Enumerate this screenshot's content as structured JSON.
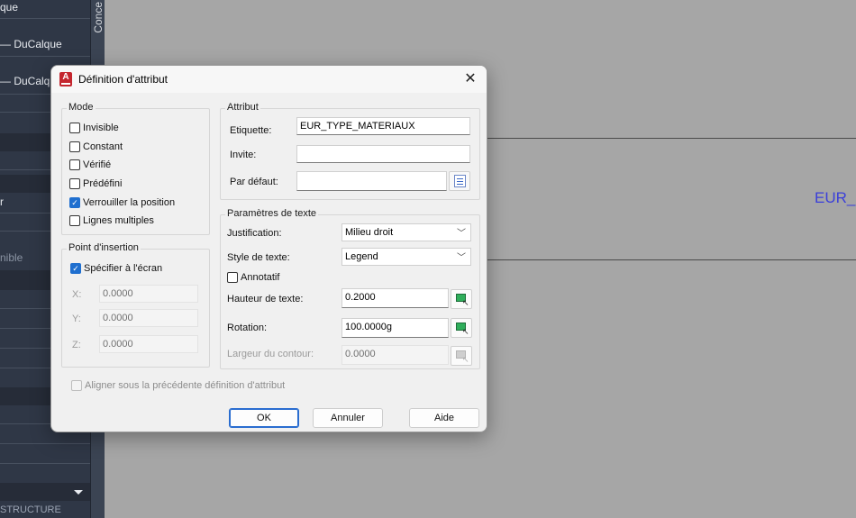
{
  "background": {
    "palette_rows": [
      "que",
      "— DuCalque",
      "— DuCalque",
      "r",
      "nible"
    ],
    "vertical_tab": "Conce",
    "bottom_label": "STRUCTURE",
    "canvas_text": "EUR_",
    "canvas_text_color": "#3b3fd9"
  },
  "dialog": {
    "title": "Définition d'attribut",
    "close_glyph": "✕",
    "mode": {
      "legend": "Mode",
      "options": [
        {
          "label": "Invisible",
          "checked": false
        },
        {
          "label": "Constant",
          "checked": false
        },
        {
          "label": "Vérifié",
          "checked": false
        },
        {
          "label": "Prédéfini",
          "checked": false
        },
        {
          "label": "Verrouiller la position",
          "checked": true
        },
        {
          "label": "Lignes multiples",
          "checked": false
        }
      ]
    },
    "insertion": {
      "legend": "Point d'insertion",
      "specify_label": "Spécifier à l'écran",
      "specify_checked": true,
      "x_label": "X:",
      "x_value": "0.0000",
      "y_label": "Y:",
      "y_value": "0.0000",
      "z_label": "Z:",
      "z_value": "0.0000"
    },
    "attribute": {
      "legend": "Attribut",
      "tag_label": "Etiquette:",
      "tag_value": "EUR_TYPE_MATERIAUX",
      "prompt_label": "Invite:",
      "prompt_value": "",
      "default_label": "Par défaut:",
      "default_value": ""
    },
    "text_settings": {
      "legend": "Paramètres de texte",
      "justification_label": "Justification:",
      "justification_value": "Milieu droit",
      "style_label": "Style de texte:",
      "style_value": "Legend",
      "annotative_label": "Annotatif",
      "annotative_checked": false,
      "height_label": "Hauteur de texte:",
      "height_value": "0.2000",
      "rotation_label": "Rotation:",
      "rotation_value": "100.0000g",
      "boundary_label": "Largeur du contour:",
      "boundary_value": "0.0000"
    },
    "align_label": "Aligner sous la précédente définition d'attribut",
    "buttons": {
      "ok": "OK",
      "cancel": "Annuler",
      "help": "Aide"
    },
    "accent_color": "#1f6fcf",
    "brand_color": "#c4262e"
  }
}
